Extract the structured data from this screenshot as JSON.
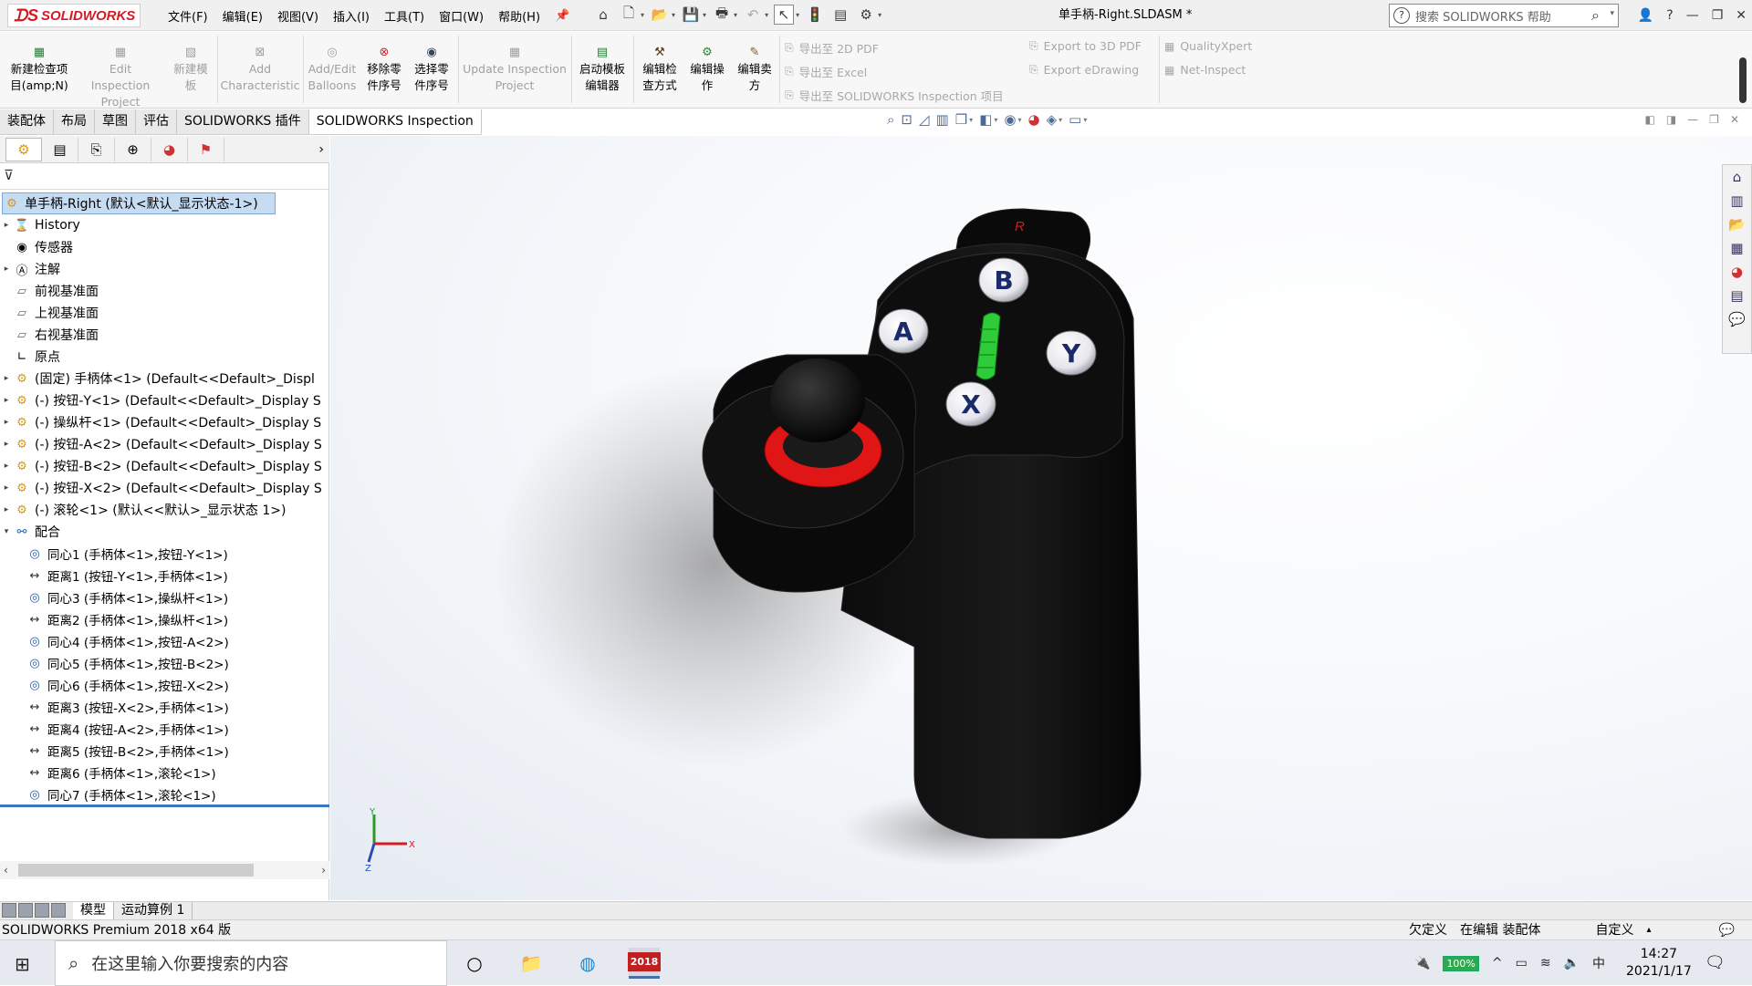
{
  "app": {
    "logo": "SOLIDWORKS",
    "doc_title": "单手柄-Right.SLDASM *"
  },
  "menu": [
    "文件(F)",
    "编辑(E)",
    "视图(V)",
    "插入(I)",
    "工具(T)",
    "窗口(W)",
    "帮助(H)"
  ],
  "search": {
    "placeholder": "搜索 SOLIDWORKS 帮助"
  },
  "ribbon": {
    "new_plan": [
      "新建检查项",
      "目(amp;N)"
    ],
    "edit_project": [
      "Edit Inspection",
      "Project"
    ],
    "new_template": [
      "新建模",
      "板"
    ],
    "add_char": [
      "Add",
      "Characteristic"
    ],
    "balloons": [
      "Add/Edit",
      "Balloons"
    ],
    "remove_seq": [
      "移除零",
      "件序号"
    ],
    "select_seq": [
      "选择零",
      "件序号"
    ],
    "update": [
      "Update Inspection",
      "Project"
    ],
    "launch_tpl": [
      "启动模板",
      "编辑器"
    ],
    "edit_method": [
      "编辑检",
      "查方式"
    ],
    "edit_op": [
      "编辑操",
      "作"
    ],
    "edit_vendor": [
      "编辑卖",
      "方"
    ],
    "export_2d": "导出至 2D PDF",
    "export_excel": "导出至 Excel",
    "export_proj": "导出至 SOLIDWORKS Inspection 项目",
    "export_3d": "Export to 3D PDF",
    "export_edrawing": "Export eDrawing",
    "qualityxpert": "QualityXpert",
    "net_inspect": "Net-Inspect"
  },
  "tabs": [
    "装配体",
    "布局",
    "草图",
    "评估",
    "SOLIDWORKS 插件",
    "SOLIDWORKS Inspection"
  ],
  "tree": {
    "root": "单手柄-Right  (默认<默认_显示状态-1>)",
    "items": [
      "History",
      "传感器",
      "注解",
      "前视基准面",
      "上视基准面",
      "右视基准面",
      "原点",
      "(固定) 手柄体<1> (Default<<Default>_Displ",
      "(-) 按钮-Y<1> (Default<<Default>_Display S",
      "(-) 操纵杆<1> (Default<<Default>_Display S",
      "(-) 按钮-A<2> (Default<<Default>_Display S",
      "(-) 按钮-B<2> (Default<<Default>_Display S",
      "(-) 按钮-X<2> (Default<<Default>_Display S",
      "(-) 滚轮<1> (默认<<默认>_显示状态 1>)",
      "配合"
    ],
    "mates": [
      "同心1 (手柄体<1>,按钮-Y<1>)",
      "距离1 (按钮-Y<1>,手柄体<1>)",
      "同心3 (手柄体<1>,操纵杆<1>)",
      "距离2 (手柄体<1>,操纵杆<1>)",
      "同心4 (手柄体<1>,按钮-A<2>)",
      "同心5 (手柄体<1>,按钮-B<2>)",
      "同心6 (手柄体<1>,按钮-X<2>)",
      "距离3 (按钮-X<2>,手柄体<1>)",
      "距离4 (按钮-A<2>,手柄体<1>)",
      "距离5 (按钮-B<2>,手柄体<1>)",
      "距离6 (手柄体<1>,滚轮<1>)",
      "同心7 (手柄体<1>,滚轮<1>)"
    ]
  },
  "model": {
    "btn_a": "A",
    "btn_b": "B",
    "btn_x": "X",
    "btn_y": "Y",
    "mark_r": "R"
  },
  "triad": {
    "x": "X",
    "y": "Y",
    "z": "Z"
  },
  "bottom_tabs": [
    "模型",
    "运动算例 1"
  ],
  "status": {
    "left": "SOLIDWORKS Premium 2018 x64 版",
    "under": "欠定义",
    "editing": "在编辑 装配体",
    "custom": "自定义"
  },
  "taskbar": {
    "search": "在这里输入你要搜索的内容",
    "battery": "100%",
    "ime": "中",
    "time": "14:27",
    "date": "2021/1/17",
    "sw_label": "2018"
  },
  "colors": {
    "accent": "#d71920",
    "selection": "#c6dcf3"
  }
}
